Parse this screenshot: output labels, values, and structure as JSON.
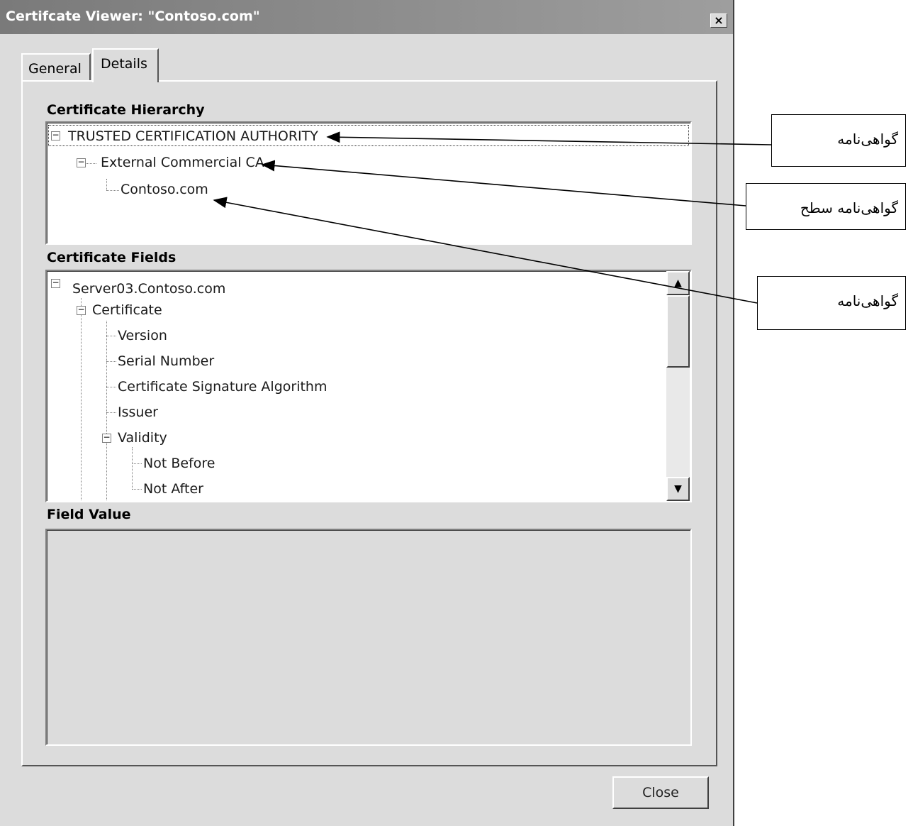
{
  "window": {
    "title": "Certifcate Viewer: \"Contoso.com\"",
    "close_glyph": "×"
  },
  "tabs": [
    {
      "label": "General"
    },
    {
      "label": "Details"
    }
  ],
  "hierarchy": {
    "label": "Certificate Hierarchy",
    "items": [
      {
        "label": "TRUSTED CERTIFICATION AUTHORITY"
      },
      {
        "label": "External Commercial CA"
      },
      {
        "label": "Contoso.com"
      }
    ]
  },
  "fields": {
    "label": "Certificate Fields",
    "items": [
      {
        "label": "Server03.Contoso.com"
      },
      {
        "label": "Certificate"
      },
      {
        "label": "Version"
      },
      {
        "label": "Serial Number"
      },
      {
        "label": "Certificate Signature Algorithm"
      },
      {
        "label": "Issuer"
      },
      {
        "label": "Validity"
      },
      {
        "label": "Not Before"
      },
      {
        "label": "Not After"
      }
    ]
  },
  "field_value": {
    "label": "Field Value",
    "value": ""
  },
  "buttons": {
    "close_label": "Close"
  },
  "annotations": [
    {
      "text": "گواهی‌نامه"
    },
    {
      "text": "گواهی‌نامه سطح"
    },
    {
      "text": "گواهی‌نامه"
    }
  ]
}
